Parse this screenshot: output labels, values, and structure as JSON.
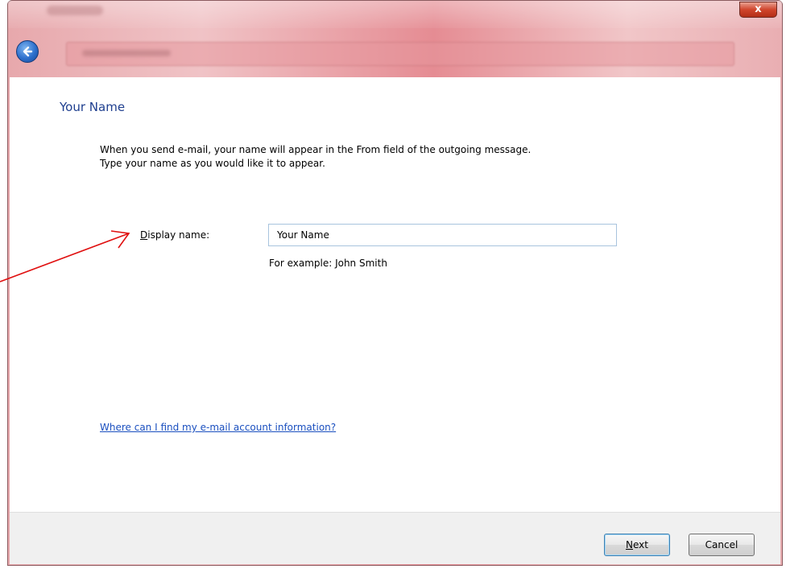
{
  "window": {
    "close_glyph": "x"
  },
  "page": {
    "heading": "Your Name",
    "description_line1": "When you send e-mail, your name will appear in the From field of the outgoing message.",
    "description_line2": "Type your name as you would like it to appear."
  },
  "form": {
    "display_name_label_accel": "D",
    "display_name_label_rest": "isplay name:",
    "display_name_value": "Your Name",
    "example_text": "For example: John Smith"
  },
  "help": {
    "link_text": "Where can I find my e-mail account information?"
  },
  "buttons": {
    "next_accel": "N",
    "next_rest": "ext",
    "cancel": "Cancel"
  },
  "colors": {
    "heading": "#1f3f8f",
    "link": "#1a4fbf",
    "annotation_arrow": "#e01010",
    "frame": "#e58c93"
  },
  "icons": {
    "back": "back-arrow-icon",
    "close": "close-icon"
  }
}
